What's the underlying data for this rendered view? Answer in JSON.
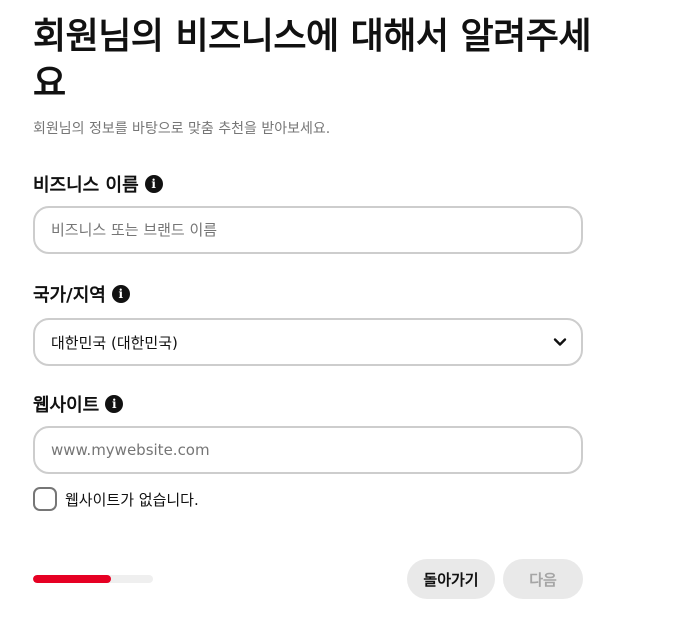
{
  "header": {
    "title": "회원님의 비즈니스에 대해서 알려주세요",
    "subtitle": "회원님의 정보를 바탕으로 맞춤 추천을 받아보세요."
  },
  "fields": {
    "business_name": {
      "label": "비즈니스 이름",
      "placeholder": "비즈니스 또는 브랜드 이름",
      "value": ""
    },
    "country": {
      "label": "국가/지역",
      "selected": "대한민국 (대한민국)"
    },
    "website": {
      "label": "웹사이트",
      "placeholder": "www.mywebsite.com",
      "value": ""
    }
  },
  "no_website": {
    "label": "웹사이트가 없습니다.",
    "checked": false
  },
  "progress": {
    "fraction": 0.65
  },
  "footer": {
    "back_label": "돌아가기",
    "next_label": "다음"
  },
  "colors": {
    "accent": "#e60023",
    "disabled_text": "#a5a5a5",
    "button_bg": "#e9e9e9"
  }
}
